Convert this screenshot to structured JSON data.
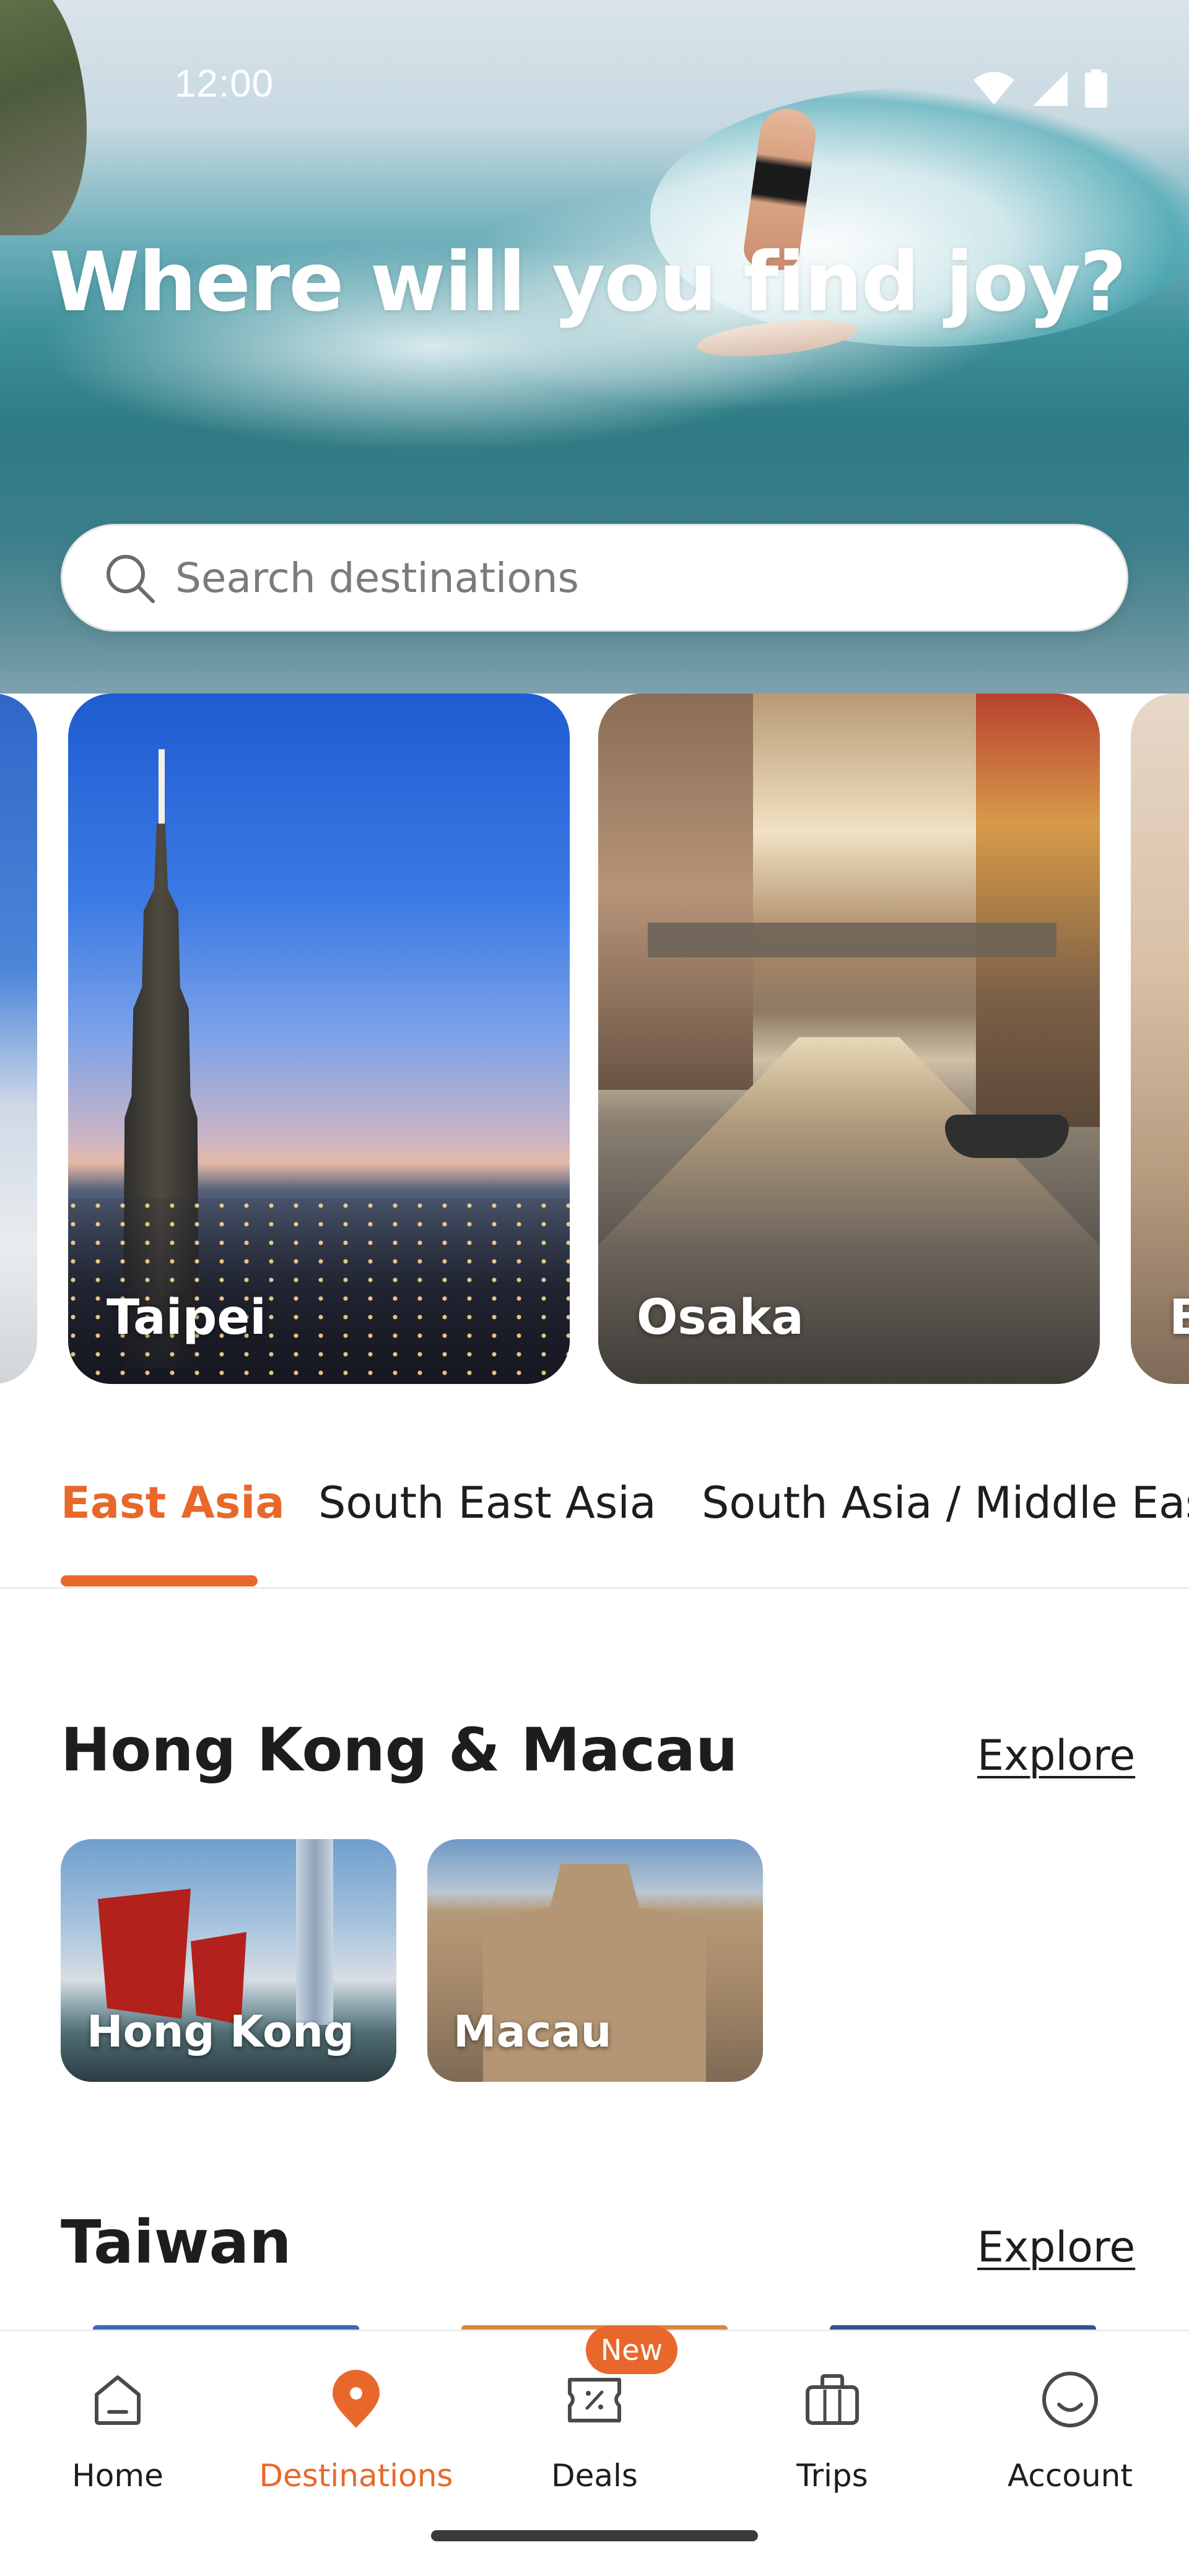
{
  "status_bar": {
    "time": "12:00",
    "icons": [
      "wifi-icon",
      "cell-signal-icon",
      "battery-icon"
    ]
  },
  "hero": {
    "title": "Where will you find joy?"
  },
  "search": {
    "placeholder": "Search destinations",
    "value": ""
  },
  "carousel": {
    "cards": [
      {
        "label": ""
      },
      {
        "label": "Taipei"
      },
      {
        "label": "Osaka"
      },
      {
        "label": "B"
      }
    ]
  },
  "region_tabs": {
    "active_index": 0,
    "tabs": [
      {
        "label": "East Asia"
      },
      {
        "label": "South East Asia"
      },
      {
        "label": "South Asia / Middle East"
      }
    ]
  },
  "sections": [
    {
      "title": "Hong Kong & Macau",
      "explore_label": "Explore",
      "cities": [
        {
          "label": "Hong Kong"
        },
        {
          "label": "Macau"
        }
      ]
    },
    {
      "title": "Taiwan",
      "explore_label": "Explore",
      "cities": []
    }
  ],
  "bottom_nav": {
    "active_index": 1,
    "items": [
      {
        "label": "Home",
        "icon": "home-icon"
      },
      {
        "label": "Destinations",
        "icon": "location-pin-icon"
      },
      {
        "label": "Deals",
        "icon": "ticket-icon",
        "badge": "New"
      },
      {
        "label": "Trips",
        "icon": "briefcase-icon"
      },
      {
        "label": "Account",
        "icon": "smiley-icon"
      }
    ]
  },
  "colors": {
    "accent": "#e8682b",
    "text": "#1d1d1d",
    "muted_text": "#7b7b7b",
    "divider": "#ececec"
  }
}
